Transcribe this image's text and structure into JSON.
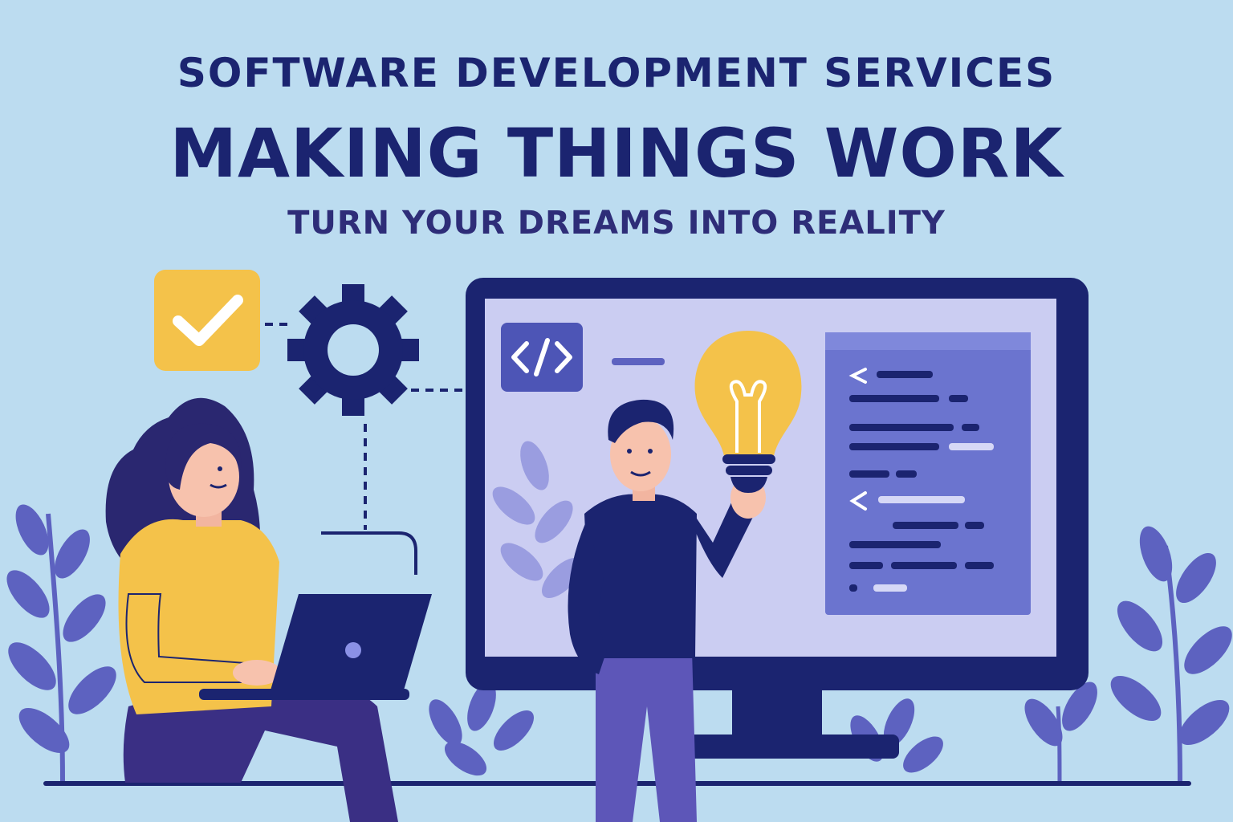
{
  "header": {
    "eyebrow": "SOFTWARE DEVELOPMENT SERVICES",
    "title": "MAKING THINGS WORK",
    "tagline": "TURN YOUR DREAMS INTO REALITY"
  },
  "icons": {
    "code_badge": "code-brackets-icon",
    "checkbox": "checkmark-icon",
    "gear": "gear-icon",
    "idea": "lightbulb-icon",
    "laptop": "laptop-icon"
  },
  "colors": {
    "background": "#bcdcf0",
    "navy": "#1b2470",
    "accent_yellow": "#f4c24a",
    "plant_purple": "#5d62c0",
    "screen": "#cbcdf2",
    "code_panel": "#6b74cf"
  }
}
